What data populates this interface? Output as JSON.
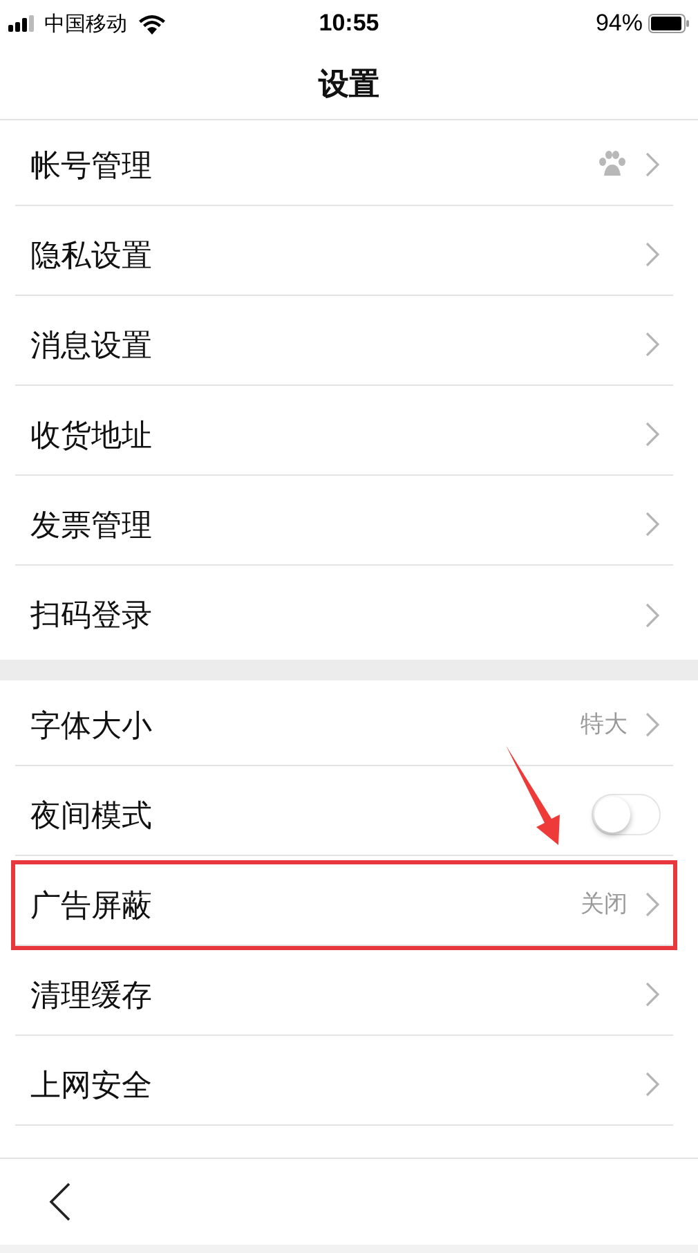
{
  "status_bar": {
    "carrier": "中国移动",
    "time": "10:55",
    "battery": "94%"
  },
  "nav": {
    "title": "设置"
  },
  "groups": [
    {
      "items": [
        {
          "kind": "account",
          "label": "帐号管理"
        },
        {
          "kind": "link",
          "label": "隐私设置"
        },
        {
          "kind": "link",
          "label": "消息设置"
        },
        {
          "kind": "link",
          "label": "收货地址"
        },
        {
          "kind": "link",
          "label": "发票管理"
        },
        {
          "kind": "link",
          "label": "扫码登录"
        }
      ]
    },
    {
      "items": [
        {
          "kind": "link",
          "label": "字体大小",
          "value": "特大",
          "highlighted": false
        },
        {
          "kind": "toggle",
          "label": "夜间模式",
          "on": false
        },
        {
          "kind": "link",
          "label": "广告屏蔽",
          "value": "关闭",
          "highlighted": true
        },
        {
          "kind": "link",
          "label": "清理缓存",
          "highlighted": false
        },
        {
          "kind": "link",
          "label": "上网安全",
          "highlighted": false
        }
      ]
    }
  ]
}
